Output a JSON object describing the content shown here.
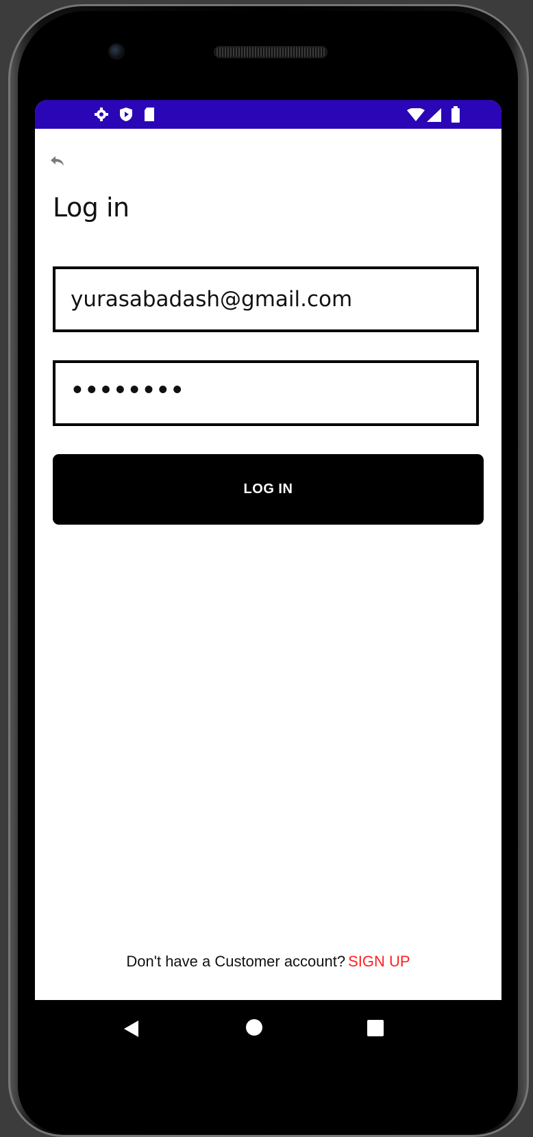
{
  "app": {
    "screen_title": "Log in"
  },
  "status_bar": {
    "left_icons": [
      "gear-icon",
      "shield-icon",
      "sd-card-icon"
    ],
    "right_icons": [
      "wifi-icon",
      "signal-icon",
      "battery-icon"
    ],
    "color": "#2a06b6"
  },
  "form": {
    "email_value": "yurasabadash@gmail.com",
    "password_value": "••••••••"
  },
  "login_button": {
    "label": "LOG IN"
  },
  "footer": {
    "prompt": "Don't have a Customer account?",
    "signup_label": "SIGN UP",
    "signup_color": "#ff1f1f"
  },
  "nav_bar": {
    "icons": [
      "back-triangle-icon",
      "home-circle-icon",
      "recents-square-icon"
    ]
  }
}
